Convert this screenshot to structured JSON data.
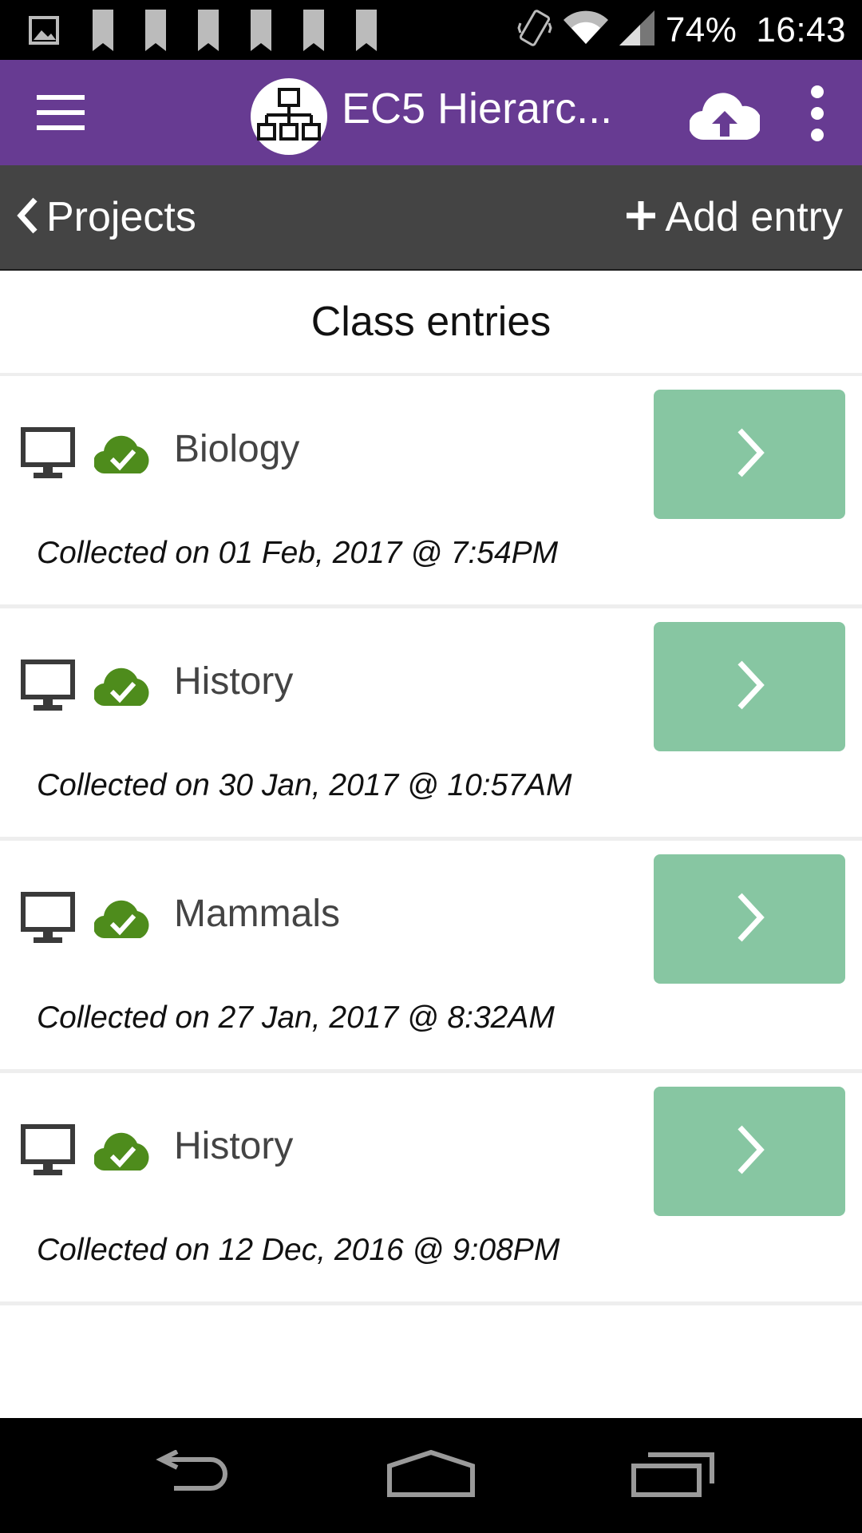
{
  "status_bar": {
    "battery": "74%",
    "time": "16:43",
    "left_icons": [
      "image-notification-icon",
      "bookmark-icon",
      "bookmark-icon",
      "bookmark-icon",
      "bookmark-icon",
      "bookmark-icon",
      "bookmark-icon"
    ],
    "right_icons": [
      "vibrate-icon",
      "wifi-icon",
      "signal-icon"
    ]
  },
  "app_bar": {
    "title": "EC5 Hierarc...",
    "menu_icon": "hamburger-menu-icon",
    "logo_icon": "hierarchy-logo-icon",
    "upload_icon": "cloud-upload-icon",
    "more_icon": "more-vert-icon",
    "background": "#673b92"
  },
  "sub_bar": {
    "back_label": "Projects",
    "add_label": "Add entry",
    "background": "#444444"
  },
  "page": {
    "heading": "Class entries"
  },
  "entries": [
    {
      "title": "Biology",
      "collected": "Collected on 01 Feb, 2017 @ 7:54PM"
    },
    {
      "title": "History",
      "collected": "Collected on 30 Jan, 2017 @ 10:57AM"
    },
    {
      "title": "Mammals",
      "collected": "Collected on 27 Jan, 2017 @ 8:32AM"
    },
    {
      "title": "History",
      "collected": "Collected on 12 Dec, 2016 @ 9:08PM"
    }
  ],
  "colors": {
    "view_button": "#87c6a2",
    "synced_cloud": "#4e8c1c",
    "device_icon": "#3a3a3a"
  },
  "nav_bar": {
    "icons": [
      "back-nav-icon",
      "home-nav-icon",
      "recents-nav-icon"
    ]
  }
}
